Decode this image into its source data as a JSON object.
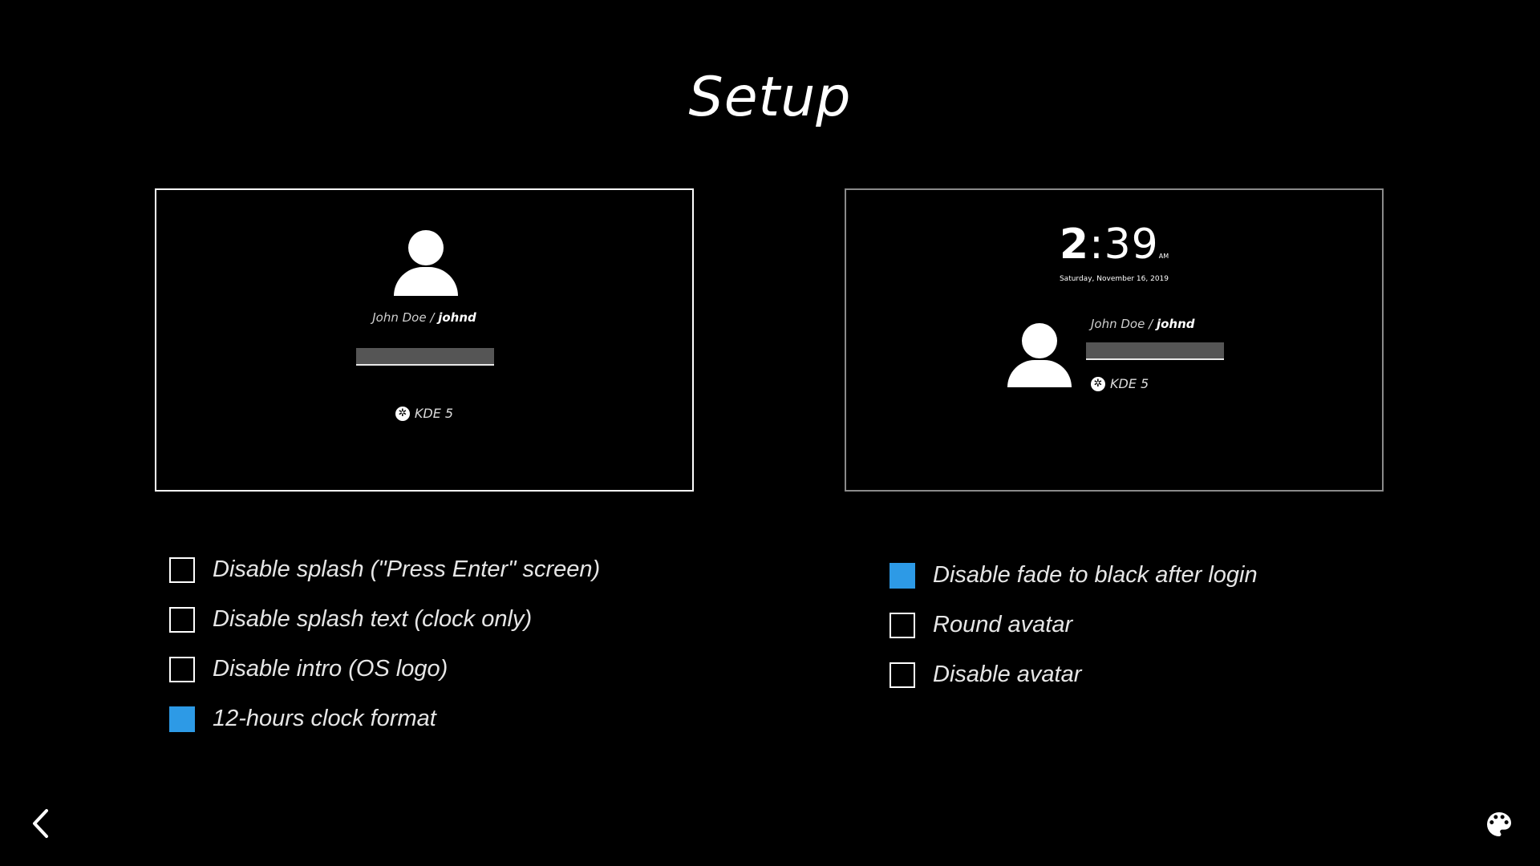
{
  "page": {
    "title": "Setup"
  },
  "preview_left": {
    "user_fullname": "John Doe /",
    "user_login": "johnd",
    "session_label": "KDE 5"
  },
  "preview_right": {
    "clock_hour": "2",
    "clock_minutes": ":39",
    "clock_ampm": "AM",
    "date": "Saturday, November 16, 2019",
    "user_fullname": "John Doe /",
    "user_login": "johnd",
    "session_label": "KDE 5"
  },
  "options_left": [
    {
      "label": "Disable splash (\"Press Enter\" screen)",
      "checked": false
    },
    {
      "label": "Disable splash text (clock only)",
      "checked": false
    },
    {
      "label": "Disable intro (OS logo)",
      "checked": false
    },
    {
      "label": "12-hours clock format",
      "checked": true
    }
  ],
  "options_right": [
    {
      "label": "Disable fade to black after login",
      "checked": true
    },
    {
      "label": "Round avatar",
      "checked": false
    },
    {
      "label": "Disable avatar",
      "checked": false
    }
  ],
  "colors": {
    "accent": "#2d9ae6",
    "background": "#000000",
    "foreground": "#ffffff"
  },
  "icons": {
    "back": "chevron-left-icon",
    "theme": "palette-icon",
    "session": "kde-icon",
    "avatar": "user-icon"
  }
}
